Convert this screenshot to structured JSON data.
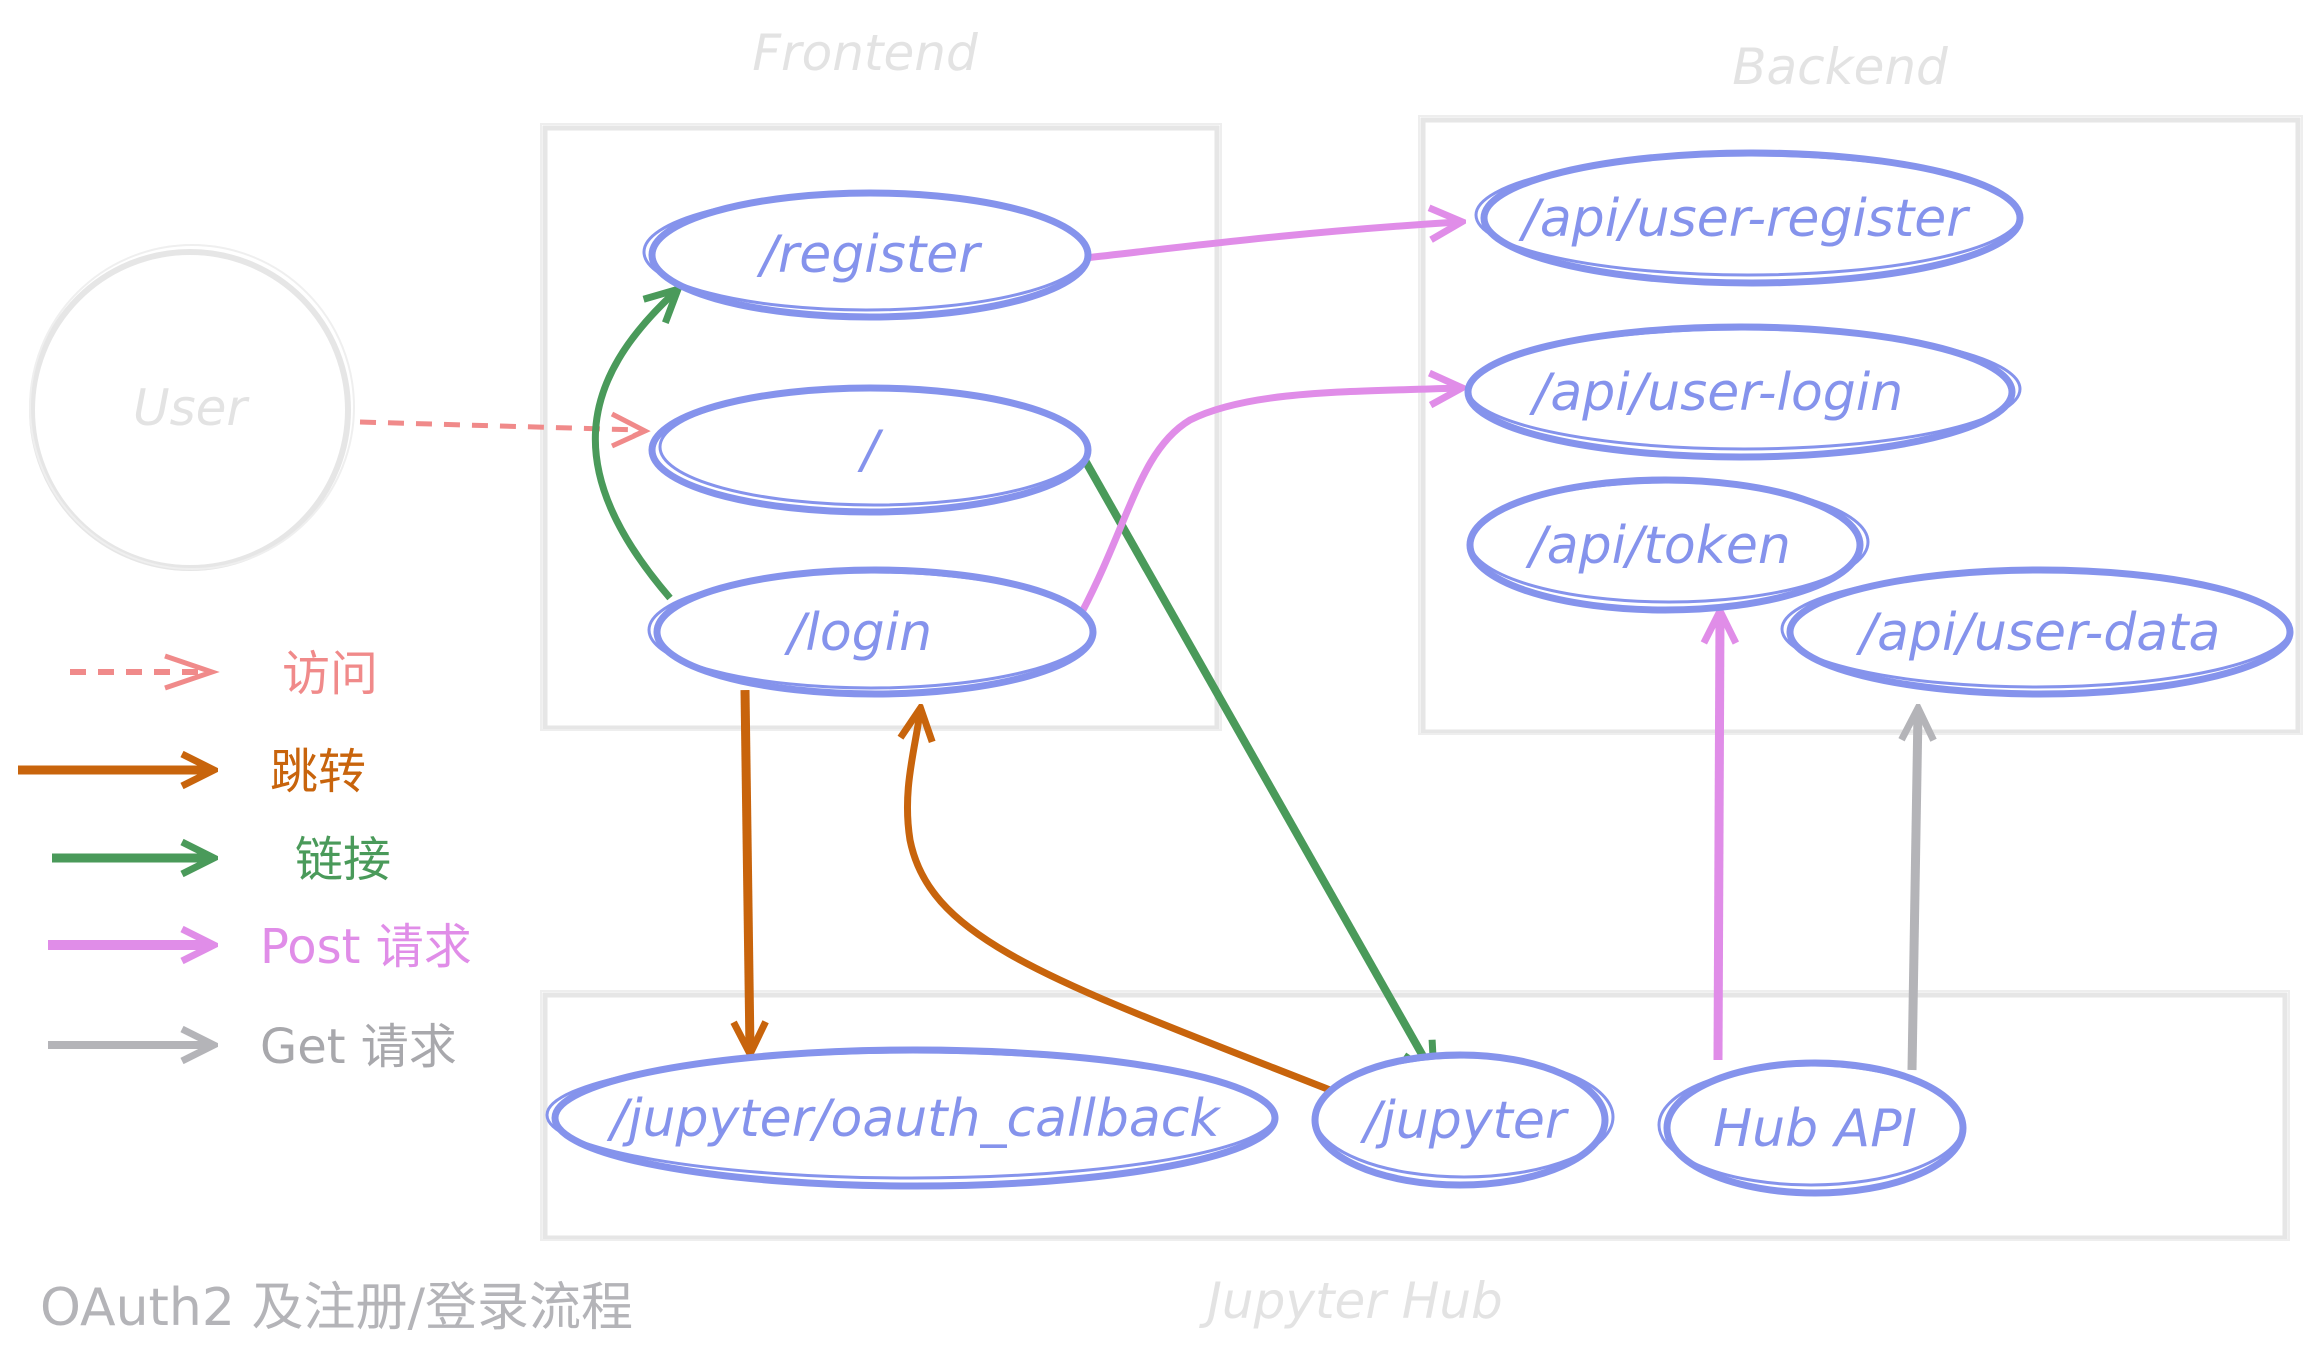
{
  "colors": {
    "node_stroke": "#8593ec",
    "group_stroke": "#e6e6e6",
    "visit": "#f08a8a",
    "redirect": "#c8640c",
    "link": "#4a9a5a",
    "post": "#e08de8",
    "get": "#b4b4b8"
  },
  "groups": {
    "frontend": "Frontend",
    "backend": "Backend",
    "jupyterhub": "Jupyter Hub"
  },
  "actors": {
    "user": "User"
  },
  "nodes": {
    "register": "/register",
    "root": "/",
    "login": "/login",
    "api_user_register": "/api/user-register",
    "api_user_login": "/api/user-login",
    "api_token": "/api/token",
    "api_user_data": "/api/user-data",
    "oauth_callback": "/jupyter/oauth_callback",
    "jupyter": "/jupyter",
    "hub_api": "Hub API"
  },
  "legend": {
    "visit": "访问",
    "redirect": "跳转",
    "link": "链接",
    "post": "Post 请求",
    "get": "Get 请求"
  },
  "caption": "OAuth2 及注册/登录流程"
}
